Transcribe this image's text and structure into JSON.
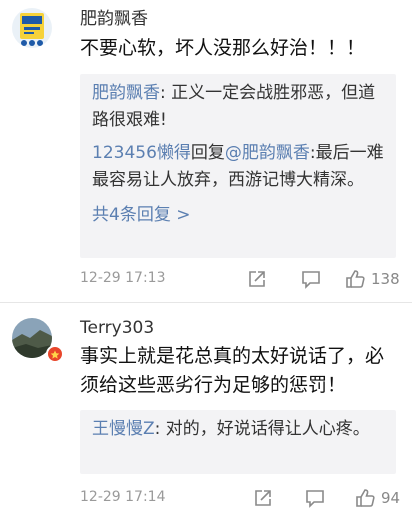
{
  "comments": [
    {
      "username": "肥韵飘香",
      "content": "不要心软，坏人没那么好治！！！",
      "replies": [
        {
          "author": "肥韵飘香",
          "sep": ": ",
          "text": "正义一定会战胜邪恶，但道路很艰难!"
        },
        {
          "author": "123456懒得",
          "mid": "回复",
          "target": "@肥韵飘香",
          "sep": ":",
          "text": "最后一难最容易让人放弃，西游记博大精深。"
        }
      ],
      "more": "共4条回复 >",
      "time": "12-29 17:13",
      "likes": "138"
    },
    {
      "username": "Terry303",
      "content": "事实上就是花总真的太好说话了，必须给这些恶劣行为足够的惩罚！",
      "replies": [
        {
          "author": "王慢慢Z",
          "sep": ": ",
          "text": "对的，好说话得让人心疼。"
        }
      ],
      "time": "12-29 17:14",
      "likes": "94"
    }
  ],
  "colors": {
    "accent": "#5b7fb1",
    "badge": "#e8462b",
    "reply_bg": "#f3f3f5"
  }
}
